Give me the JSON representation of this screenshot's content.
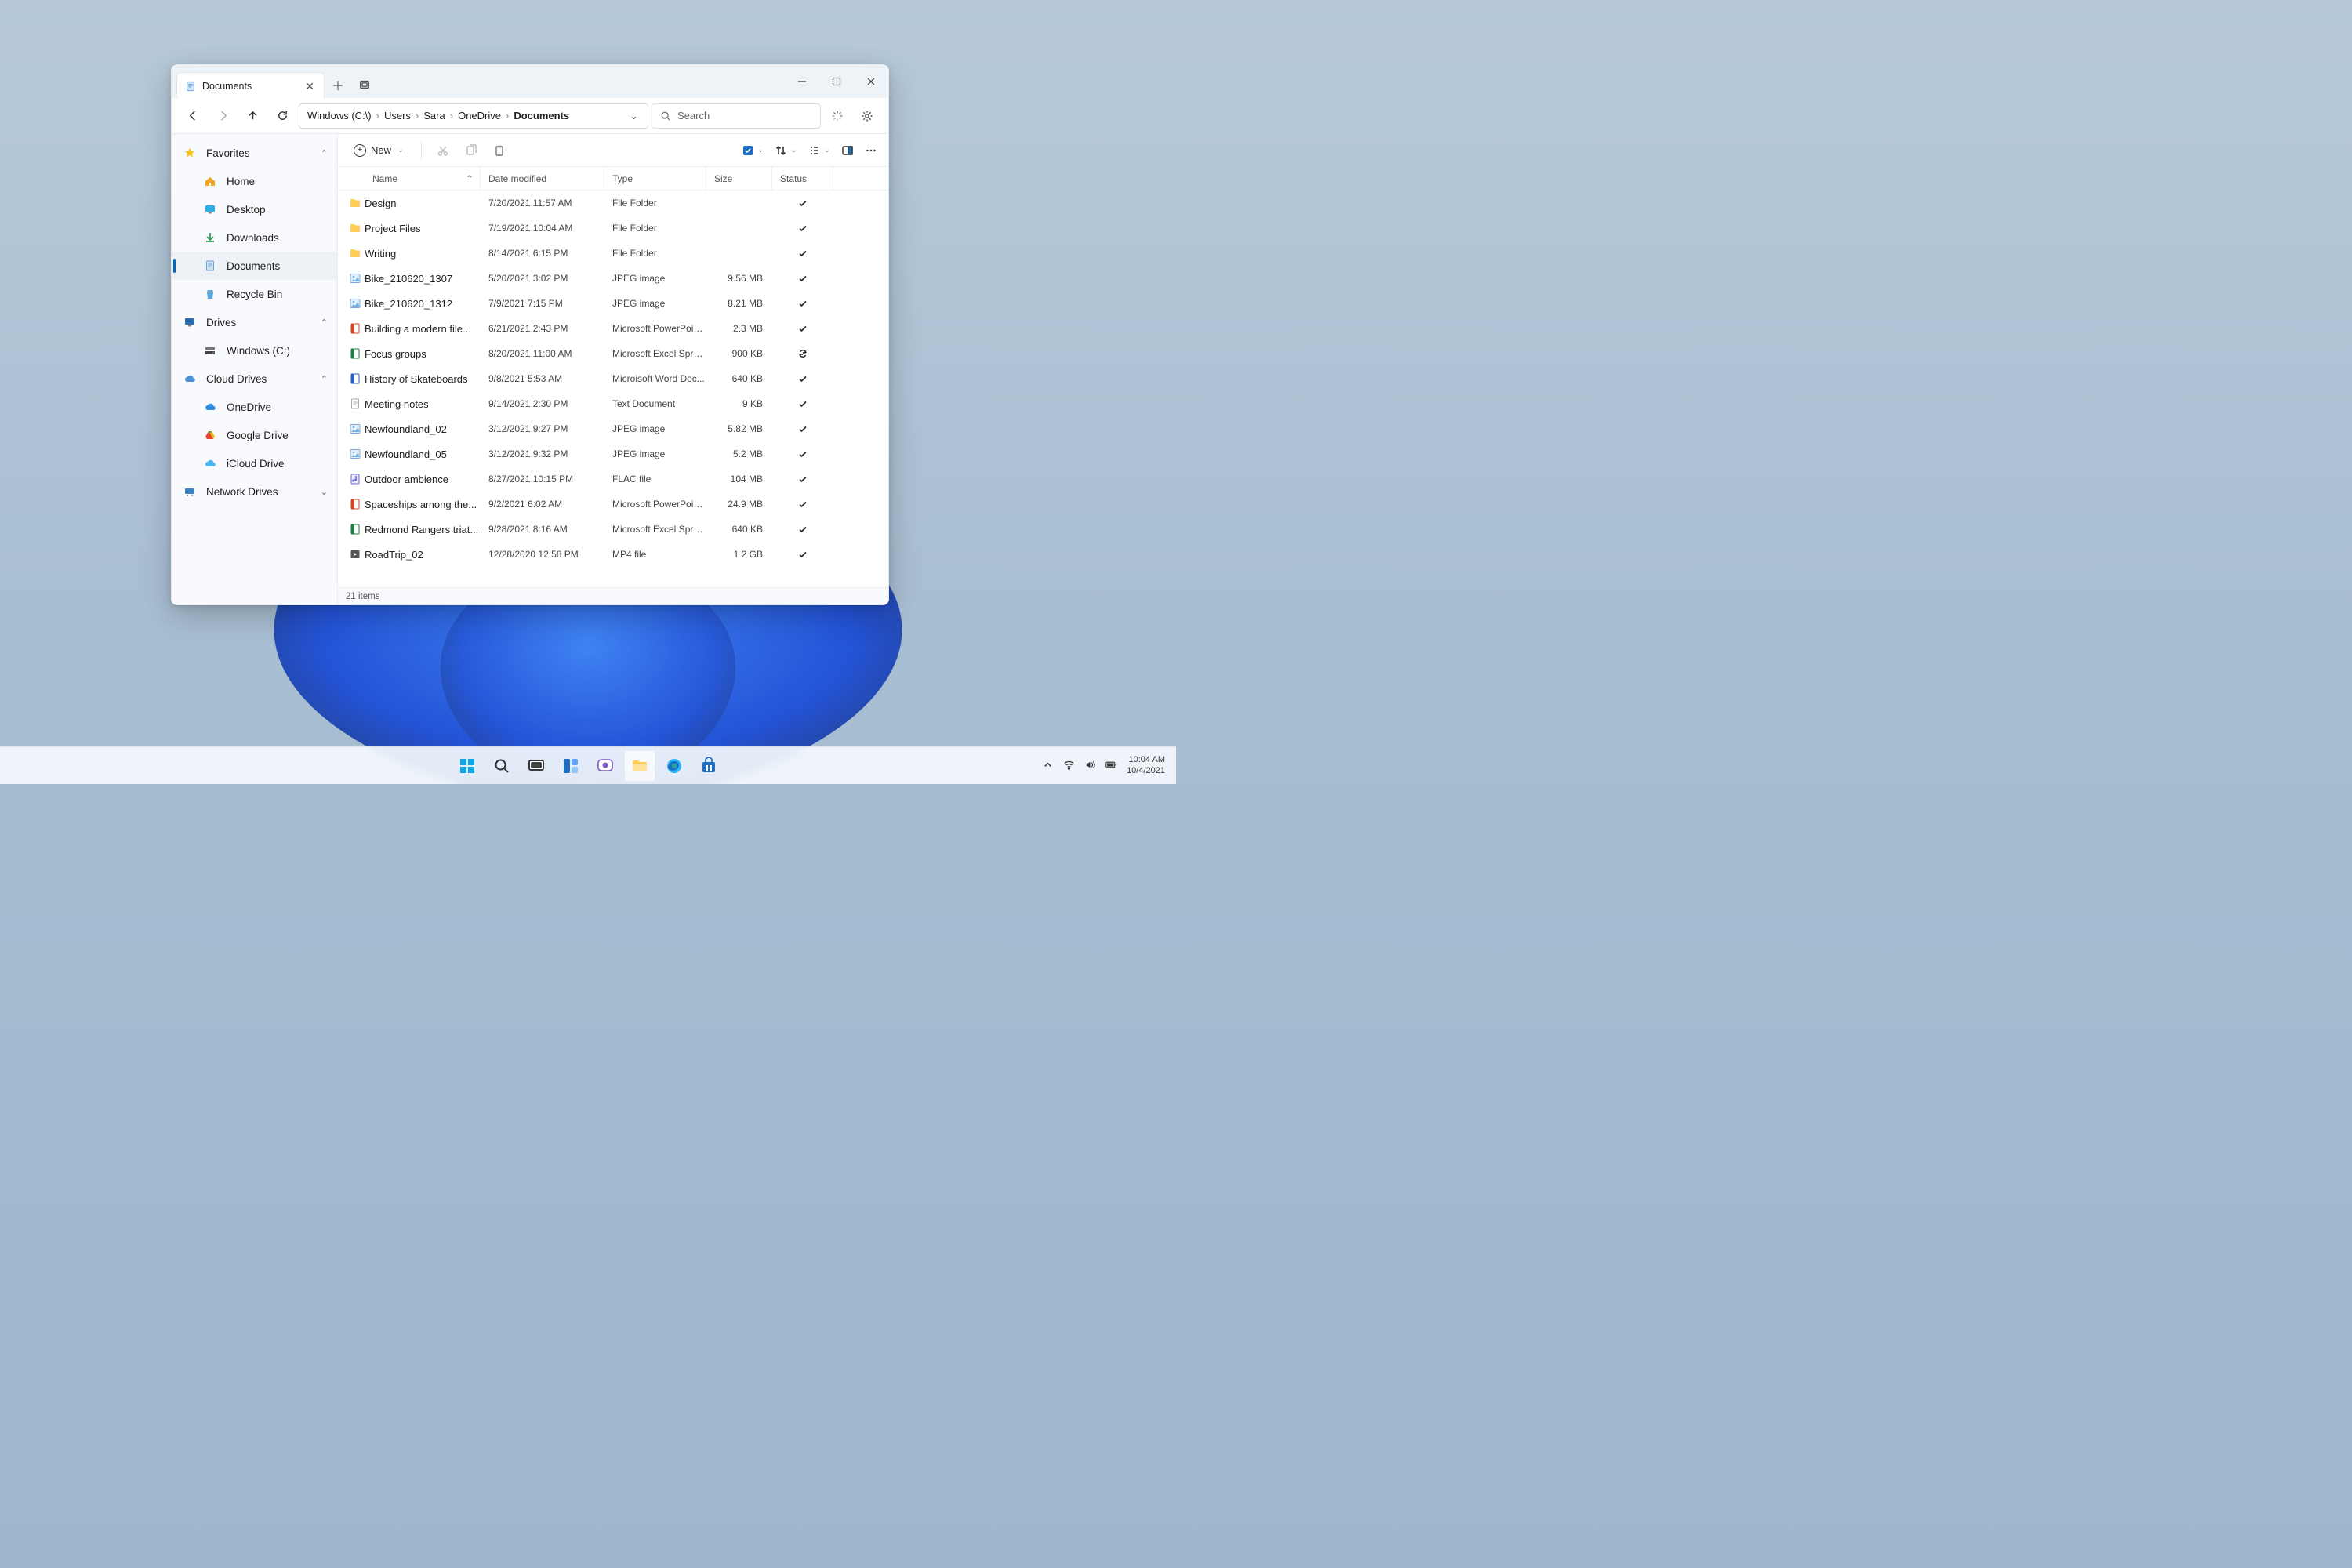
{
  "tab": {
    "title": "Documents"
  },
  "breadcrumb": [
    "Windows (C:\\)",
    "Users",
    "Sara",
    "OneDrive",
    "Documents"
  ],
  "search": {
    "placeholder": "Search"
  },
  "toolbar": {
    "new_label": "New"
  },
  "sidebar": {
    "groups": [
      {
        "label": "Favorites",
        "icon": "star",
        "expanded": true,
        "items": [
          {
            "label": "Home",
            "icon": "home"
          },
          {
            "label": "Desktop",
            "icon": "desktop"
          },
          {
            "label": "Downloads",
            "icon": "download"
          },
          {
            "label": "Documents",
            "icon": "document",
            "active": true
          },
          {
            "label": "Recycle Bin",
            "icon": "recycle"
          }
        ]
      },
      {
        "label": "Drives",
        "icon": "monitor",
        "expanded": true,
        "items": [
          {
            "label": "Windows (C:)",
            "icon": "drive"
          }
        ]
      },
      {
        "label": "Cloud Drives",
        "icon": "cloud",
        "expanded": true,
        "items": [
          {
            "label": "OneDrive",
            "icon": "onedrive"
          },
          {
            "label": "Google Drive",
            "icon": "gdrive"
          },
          {
            "label": "iCloud Drive",
            "icon": "icloud"
          }
        ]
      },
      {
        "label": "Network Drives",
        "icon": "network",
        "expanded": false,
        "items": []
      }
    ]
  },
  "columns": {
    "name": "Name",
    "date": "Date modified",
    "type": "Type",
    "size": "Size",
    "status": "Status"
  },
  "files": [
    {
      "icon": "folder",
      "name": "Design",
      "date": "7/20/2021  11:57 AM",
      "type": "File Folder",
      "size": "",
      "status": "check"
    },
    {
      "icon": "folder",
      "name": "Project Files",
      "date": "7/19/2021  10:04 AM",
      "type": "File Folder",
      "size": "",
      "status": "check"
    },
    {
      "icon": "folder",
      "name": "Writing",
      "date": "8/14/2021  6:15 PM",
      "type": "File Folder",
      "size": "",
      "status": "check"
    },
    {
      "icon": "image",
      "name": "Bike_210620_1307",
      "date": "5/20/2021  3:02 PM",
      "type": "JPEG image",
      "size": "9.56 MB",
      "status": "check"
    },
    {
      "icon": "image",
      "name": "Bike_210620_1312",
      "date": "7/9/2021  7:15 PM",
      "type": "JPEG image",
      "size": "8.21 MB",
      "status": "check"
    },
    {
      "icon": "ppt",
      "name": "Building a modern file...",
      "date": "6/21/2021  2:43 PM",
      "type": "Microsoft PowerPoint...",
      "size": "2.3 MB",
      "status": "check"
    },
    {
      "icon": "xls",
      "name": "Focus groups",
      "date": "8/20/2021  11:00 AM",
      "type": "Microsoft Excel Sprea...",
      "size": "900 KB",
      "status": "sync"
    },
    {
      "icon": "doc",
      "name": "History of Skateboards",
      "date": "9/8/2021  5:53 AM",
      "type": "Microisoft Word Doc...",
      "size": "640 KB",
      "status": "check"
    },
    {
      "icon": "txt",
      "name": "Meeting notes",
      "date": "9/14/2021  2:30 PM",
      "type": "Text Document",
      "size": "9 KB",
      "status": "check"
    },
    {
      "icon": "image",
      "name": "Newfoundland_02",
      "date": "3/12/2021  9:27 PM",
      "type": "JPEG image",
      "size": "5.82 MB",
      "status": "check"
    },
    {
      "icon": "image",
      "name": "Newfoundland_05",
      "date": "3/12/2021  9:32 PM",
      "type": "JPEG image",
      "size": "5.2 MB",
      "status": "check"
    },
    {
      "icon": "audio",
      "name": "Outdoor ambience",
      "date": "8/27/2021  10:15 PM",
      "type": "FLAC file",
      "size": "104 MB",
      "status": "check"
    },
    {
      "icon": "ppt",
      "name": "Spaceships among the...",
      "date": "9/2/2021  6:02 AM",
      "type": "Microsoft PowerPoint...",
      "size": "24.9 MB",
      "status": "check"
    },
    {
      "icon": "xls",
      "name": "Redmond Rangers triat...",
      "date": "9/28/2021  8:16 AM",
      "type": "Microsoft Excel Sprea...",
      "size": "640 KB",
      "status": "check"
    },
    {
      "icon": "video",
      "name": "RoadTrip_02",
      "date": "12/28/2020  12:58 PM",
      "type": "MP4 file",
      "size": "1.2 GB",
      "status": "check"
    }
  ],
  "statusbar": {
    "count": "21 items"
  },
  "tray": {
    "time": "10:04 AM",
    "date": "10/4/2021"
  }
}
